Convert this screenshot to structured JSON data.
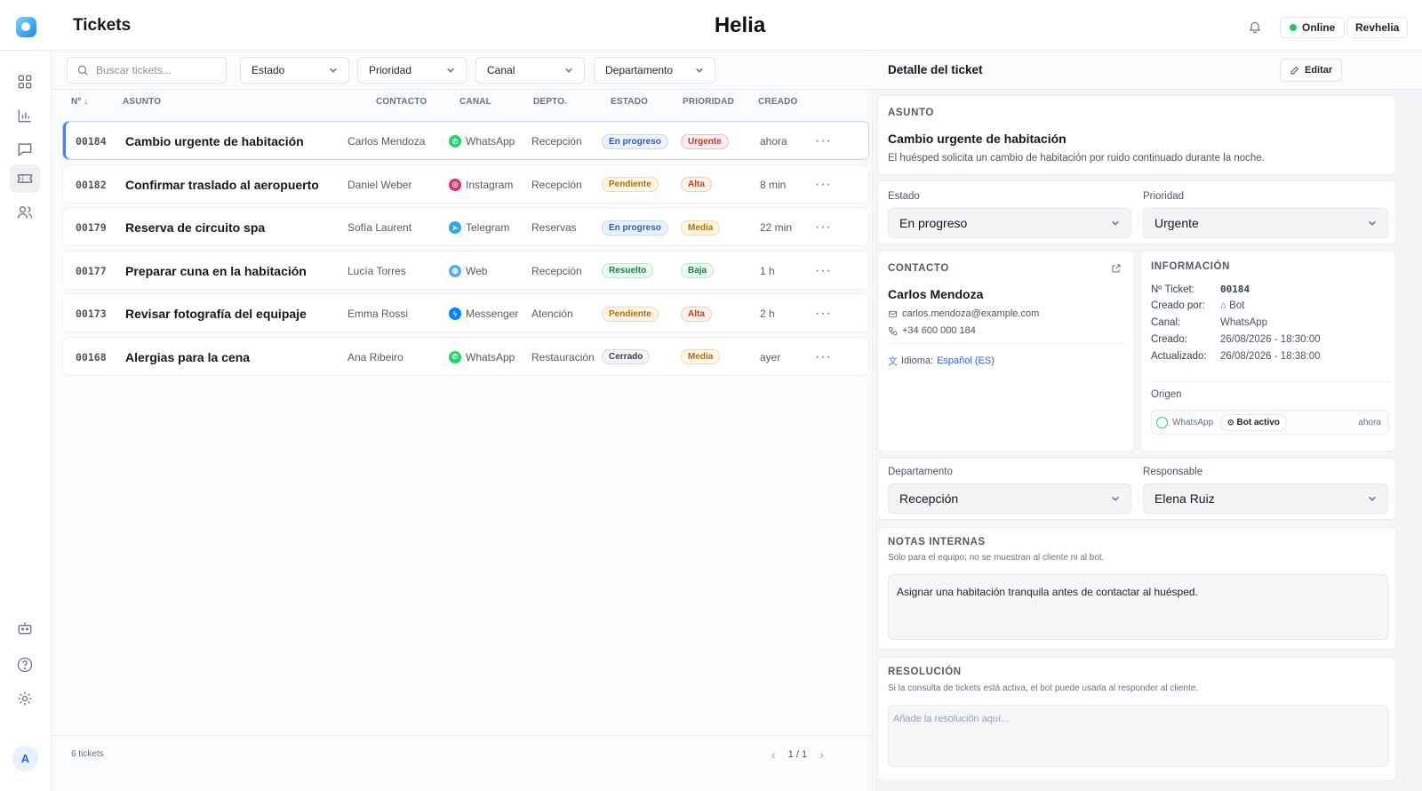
{
  "header": {
    "page_title": "Tickets",
    "brand": "Helia",
    "status": "Online",
    "user": "Revhelia"
  },
  "nav": {
    "items": [
      "dashboard-icon",
      "chart-icon",
      "chat-icon",
      "ticket-icon",
      "users-icon"
    ],
    "bottom_items": [
      "bot-icon",
      "help-icon",
      "settings-icon"
    ],
    "avatar_initial": "A"
  },
  "filters": {
    "search_placeholder": "Buscar tickets...",
    "estado": "Estado",
    "prioridad": "Prioridad",
    "canal": "Canal",
    "departamento": "Departamento"
  },
  "columns": {
    "num": "Nº",
    "asunto": "ASUNTO",
    "contacto": "CONTACTO",
    "canal": "CANAL",
    "depto": "DEPTO.",
    "estado": "ESTADO",
    "prioridad": "PRIORIDAD",
    "creado": "CREADO"
  },
  "tickets": [
    {
      "num": "00184",
      "subject": "Cambio urgente de habitación",
      "contact": "Carlos Mendoza",
      "channel": "WhatsApp",
      "dept": "Recepción",
      "status": "En progreso",
      "priority": "Urgente",
      "created": "ahora",
      "more": "···"
    },
    {
      "num": "00182",
      "subject": "Confirmar traslado al aeropuerto",
      "contact": "Daniel Weber",
      "channel": "Instagram",
      "dept": "Recepción",
      "status": "Pendiente",
      "priority": "Alta",
      "created": "8 min",
      "more": "···"
    },
    {
      "num": "00179",
      "subject": "Reserva de circuito spa",
      "contact": "Sofía Laurent",
      "channel": "Telegram",
      "dept": "Reservas",
      "status": "En progreso",
      "priority": "Media",
      "created": "22 min",
      "more": "···"
    },
    {
      "num": "00177",
      "subject": "Preparar cuna en la habitación",
      "contact": "Lucía Torres",
      "channel": "Web",
      "dept": "Recepción",
      "status": "Resuelto",
      "priority": "Baja",
      "created": "1 h",
      "more": "···"
    },
    {
      "num": "00173",
      "subject": "Revisar fotografía del equipaje",
      "contact": "Emma Rossi",
      "channel": "Messenger",
      "dept": "Atención",
      "status": "Pendiente",
      "priority": "Alta",
      "created": "2 h",
      "more": "···"
    },
    {
      "num": "00168",
      "subject": "Alergias para la cena",
      "contact": "Ana Ribeiro",
      "channel": "WhatsApp",
      "dept": "Restauración",
      "status": "Cerrado",
      "priority": "Media",
      "created": "ayer",
      "more": "···"
    }
  ],
  "footer": {
    "count": "6 tickets",
    "page": "1 / 1"
  },
  "detail": {
    "title": "Detalle del ticket",
    "edit": "Editar",
    "asunto_title": "ASUNTO",
    "subject": "Cambio urgente de habitación",
    "description": "El huésped solicita un cambio de habitación por ruido continuado durante la noche.",
    "estado_label": "Estado",
    "estado_value": "En progreso",
    "prioridad_label": "Prioridad",
    "prioridad_value": "Urgente",
    "contacto_title": "CONTACTO",
    "contact_name": "Carlos Mendoza",
    "contact_email": "carlos.mendoza@example.com",
    "contact_phone": "+34 600 000 184",
    "idioma_label": "Idioma:",
    "idioma_value": "Español (ES)",
    "info_title": "INFORMACIÓN",
    "info": {
      "ticket_k": "Nº Ticket:",
      "ticket_v": "00184",
      "creado_por_k": "Creado por:",
      "creado_por_v": "Bot",
      "canal_k": "Canal:",
      "canal_v": "WhatsApp",
      "creado_k": "Creado:",
      "creado_v": "26/08/2026 - 18:30:00",
      "actualizado_k": "Actualizado:",
      "actualizado_v": "26/08/2026 - 18:38:00"
    },
    "origen_label": "Origen",
    "origen_channel": "WhatsApp",
    "origen_bot": "Bot activo",
    "origen_time": "ahora",
    "departamento_label": "Departamento",
    "departamento_value": "Recepción",
    "responsable_label": "Responsable",
    "responsable_value": "Elena Ruiz",
    "notas_title": "NOTAS INTERNAS",
    "notas_sub": "Solo para el equipo; no se muestran al cliente ni al bot.",
    "notas_text": "Asignar una habitación tranquila antes de contactar al huésped.",
    "resolucion_title": "RESOLUCIÓN",
    "resolucion_sub": "Si la consulta de tickets está activa, el bot puede usarla al responder al cliente.",
    "resolucion_placeholder": "Añade la resolución aquí..."
  },
  "colors": {
    "accent": "#3b82f6",
    "online": "#22c55e",
    "whatsapp": "#25D366",
    "instagram": "#E1306C",
    "telegram": "#2AABEE",
    "messenger": "#0084FF",
    "web": "#60a5fa"
  }
}
